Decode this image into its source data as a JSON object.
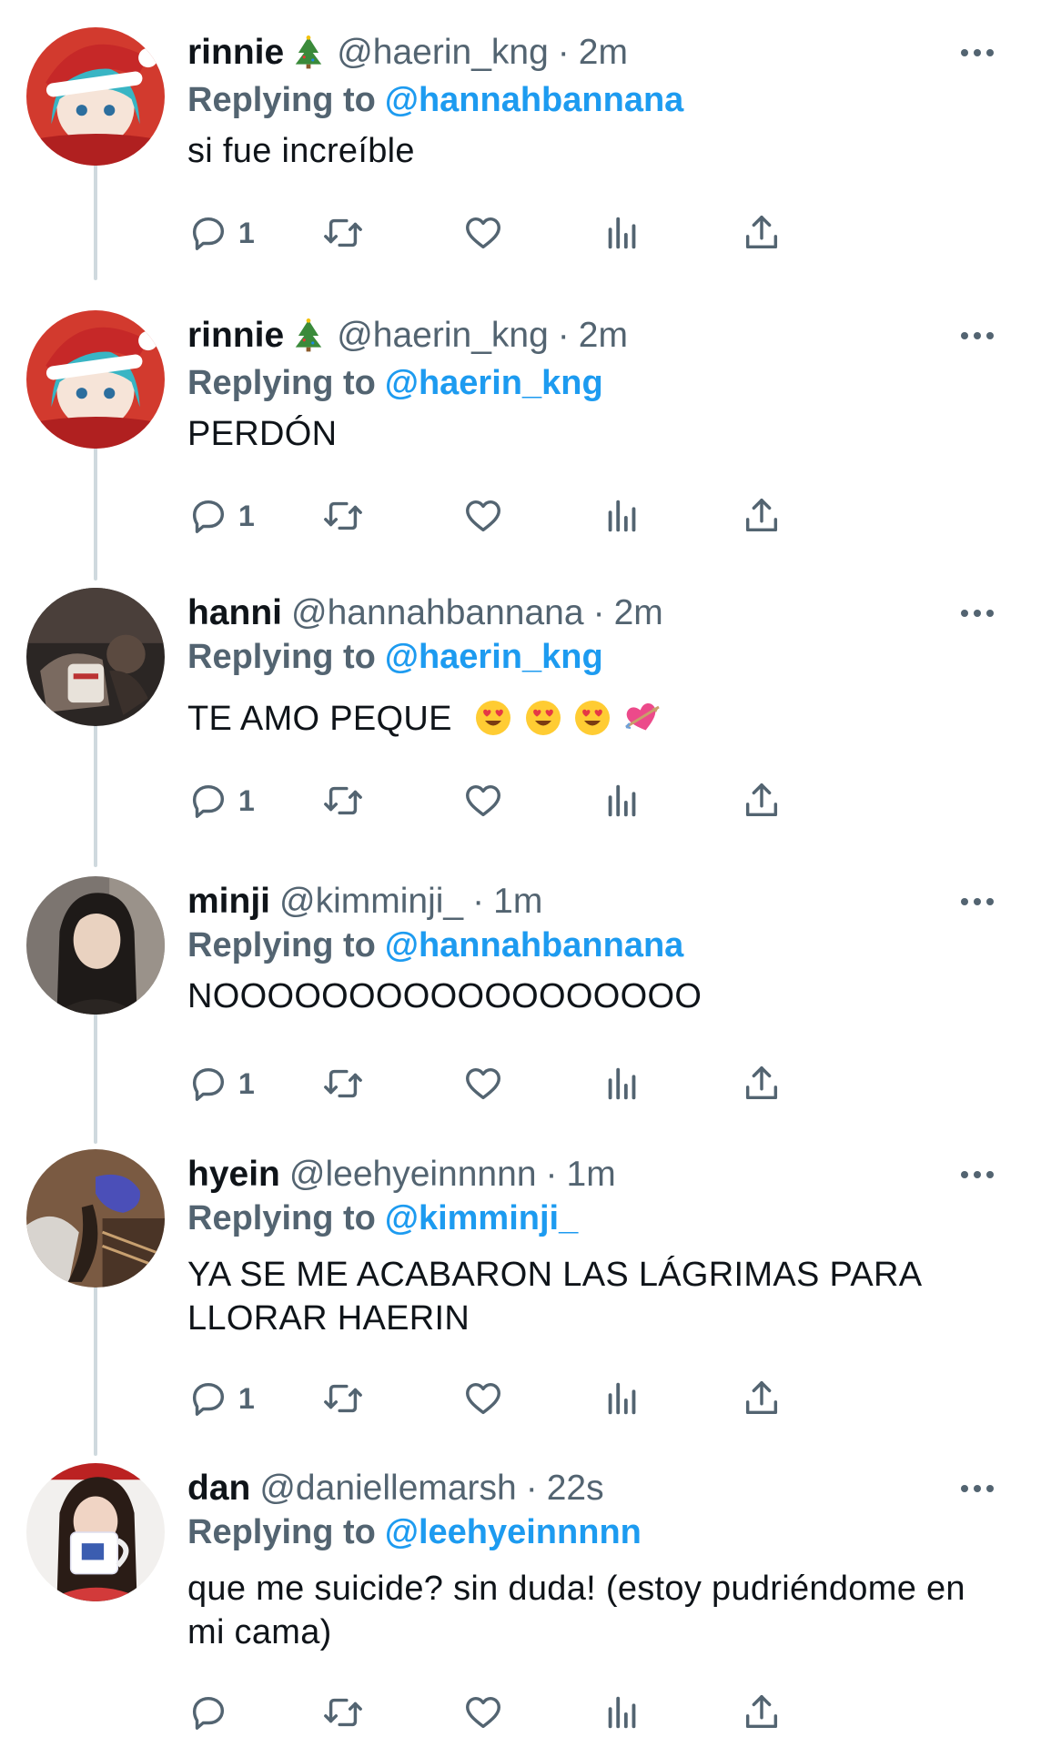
{
  "colors": {
    "accent": "#1d9bf0",
    "secondary_text": "#536471",
    "primary_text": "#0f1419",
    "thread_line": "#cfd9de"
  },
  "reply_prefix": "Replying to",
  "tweets": [
    {
      "name": "rinnie",
      "name_emoji": "christmas-tree-icon",
      "handle": "@haerin_kng",
      "time": "2m",
      "replying_to": "@hannahbannana",
      "text": "si fue increíble",
      "reply_count": "1",
      "avatar": "avatar-santa-hat-anime"
    },
    {
      "name": "rinnie",
      "name_emoji": "christmas-tree-icon",
      "handle": "@haerin_kng",
      "time": "2m",
      "replying_to": "@haerin_kng",
      "text": "PERDÓN",
      "reply_count": "1",
      "avatar": "avatar-santa-hat-anime"
    },
    {
      "name": "hanni",
      "handle": "@hannahbannana",
      "time": "2m",
      "replying_to": "@haerin_kng",
      "text": "TE AMO PEQUE",
      "text_emojis": [
        "heart-eyes-emoji",
        "heart-eyes-emoji",
        "heart-eyes-emoji",
        "heart-arrow-emoji"
      ],
      "reply_count": "1",
      "avatar": "avatar-dark-photo"
    },
    {
      "name": "minji",
      "handle": "@kimminji_",
      "time": "1m",
      "replying_to": "@hannahbannana",
      "text": "NOOOOOOOOOOOOOOOOOO",
      "reply_count": "1",
      "avatar": "avatar-portrait"
    },
    {
      "name": "hyein",
      "handle": "@leehyeinnnnn",
      "time": "1m",
      "replying_to": "@kimminji_",
      "text": "YA SE ME ACABARON LAS LÁGRIMAS PARA LLORAR HAERIN",
      "reply_count": "1",
      "avatar": "avatar-cap-photo"
    },
    {
      "name": "dan",
      "handle": "@daniellemarsh",
      "time": "22s",
      "replying_to": "@leehyeinnnnn",
      "text": "que me suicide? sin duda! (estoy pudriéndome en mi cama)",
      "reply_count": "",
      "avatar": "avatar-mug-photo"
    }
  ]
}
